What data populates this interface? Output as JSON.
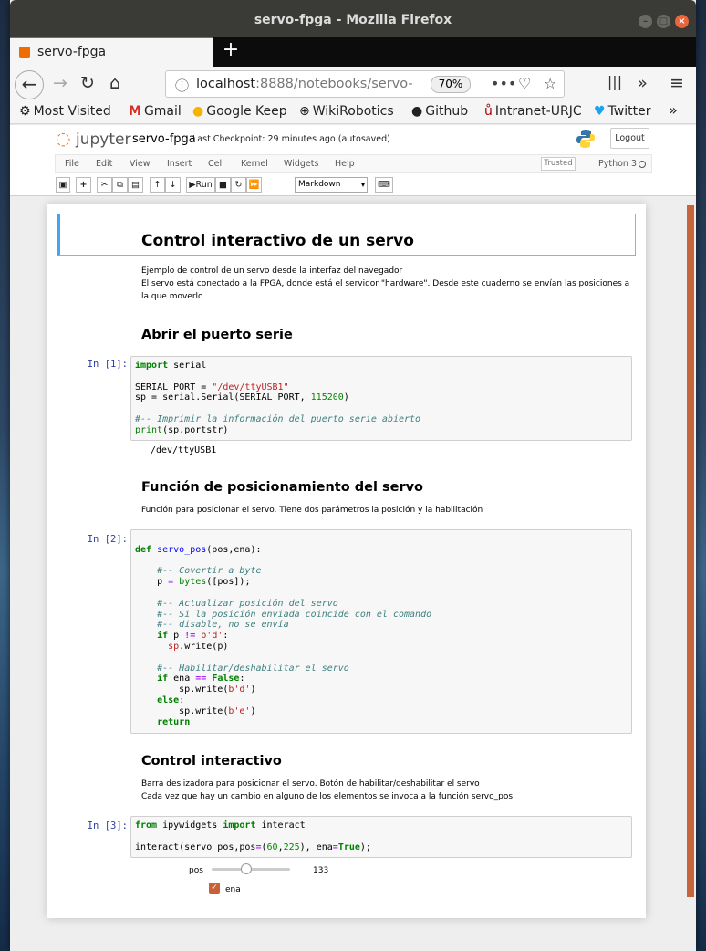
{
  "window": {
    "title": "servo-fpga - Mozilla Firefox"
  },
  "tab": {
    "label": "servo-fpga"
  },
  "url": {
    "host": "localhost",
    "rest": ":8888/notebooks/servo-",
    "zoom": "70%"
  },
  "bookmarks": [
    "Most Visited",
    "Gmail",
    "Google Keep",
    "WikiRobotics",
    "Github",
    "Intranet-URJC",
    "Twitter"
  ],
  "jupyter": {
    "logo": "jupyter",
    "notebook": "servo-fpga",
    "checkpoint": "Last Checkpoint: 29 minutes ago  (autosaved)",
    "logout": "Logout",
    "trusted": "Trusted",
    "kernel": "Python 3",
    "menu": [
      "File",
      "Edit",
      "View",
      "Insert",
      "Cell",
      "Kernel",
      "Widgets",
      "Help"
    ],
    "run": "Run",
    "celltype": "Markdown"
  },
  "cells": {
    "title": "Control interactivo de un servo",
    "intro1": "Ejemplo de control de un servo desde la interfaz del navegador",
    "intro2": "El servo está conectado a la FPGA, donde está el servidor \"hardware\". Desde este cuaderno se envían las posiciones a la que moverlo",
    "h_serial": "Abrir el puerto serie",
    "p1": "In [1]:",
    "out1": "/dev/ttyUSB1",
    "h_func": "Función de posicionamiento del servo",
    "func_desc": "Función para posicionar el servo. Tiene dos parámetros la posición y la habilitación",
    "p2": "In [2]:",
    "h_inter": "Control interactivo",
    "inter1": "Barra deslizadora para posicionar el servo. Botón de habilitar/deshabilitar el servo",
    "inter2": "Cada vez que hay un cambio en alguno de los elementos se invoca a la función servo_pos",
    "p3": "In [3]:",
    "slider_label": "pos",
    "slider_value": "133",
    "slider_fraction": 0.438,
    "checkbox_label": "ena"
  }
}
